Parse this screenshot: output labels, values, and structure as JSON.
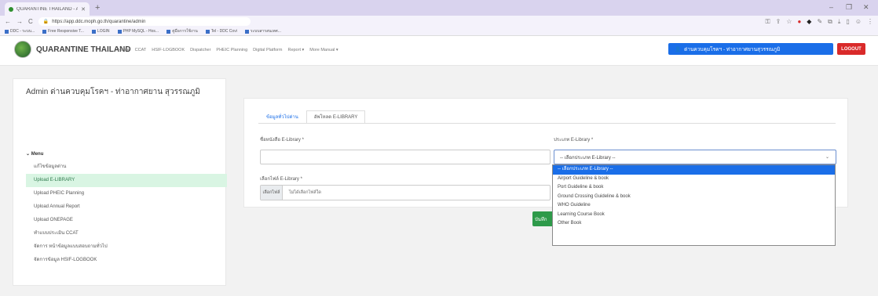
{
  "browser": {
    "tab_title": "QUARANTINE THAILAND - ADMIN",
    "new_tab": "+",
    "url": "https://app.ddc.moph.go.th/quarantine/admin",
    "nav_back": "←",
    "nav_forward": "→",
    "nav_reload": "C",
    "win_min": "–",
    "win_max": "❐",
    "win_close": "✕",
    "bookmarks": [
      "DDC - ระบบ...",
      "Free Responsive T...",
      "LOGIN",
      "PHP MySQL - Hos...",
      "คู่มือการใช้งาน",
      "Tel - DDC Covi",
      "ระบบสารสนเทศ..."
    ]
  },
  "navbar": {
    "brand": "QUARANTINE THAILAND",
    "links": [
      "Home",
      "CCAT",
      "HSIF-LOGBOOK",
      "Dispatcher",
      "PHEIC Planning",
      "Digital Platform",
      "Report ▾",
      "More Manual ▾"
    ],
    "user_label": "ด่านควบคุมโรคฯ - ท่าอากาศยานสุวรรณภูมิ",
    "logout": "LOGOUT"
  },
  "sidebar": {
    "title": "Admin ด่านควบคุมโรคฯ - ท่าอากาศยาน สุวรรณภูมิ",
    "menu_head": "⌄ Menu",
    "items": [
      {
        "label": "แก้ไขข้อมูลด่าน",
        "active": false
      },
      {
        "label": "Upload E-LIBRARY",
        "active": true
      },
      {
        "label": "Upload PHEIC Planning",
        "active": false
      },
      {
        "label": "Upload Annual Report",
        "active": false
      },
      {
        "label": "Upload ONEPAGE",
        "active": false
      },
      {
        "label": "ทำแบบประเมิน CCAT",
        "active": false
      },
      {
        "label": "จัดการ หน้าข้อมูลแบบสอบถามทั่วไป",
        "active": false
      },
      {
        "label": "จัดการข้อมูล HSIF-LOGBOOK",
        "active": false
      }
    ]
  },
  "form": {
    "tabs": [
      {
        "label": "ข้อมูลทั่วไปด่าน",
        "active": false
      },
      {
        "label": "อัพโหลด E-LIBRARY",
        "active": true
      }
    ],
    "name_label": "ชื่อหนังสือ E-Library *",
    "name_value": "",
    "file_label": "เลือกไฟล์ E-Library *",
    "file_choose": "เลือกไฟล์",
    "file_status": "ไม่ได้เลือกไฟล์ใด",
    "type_label": "ประเภท E-Library *",
    "type_value": "-- เลือกประเภท E-Library --",
    "save": "บันทึก"
  },
  "dropdown": {
    "options": [
      {
        "label": "-- เลือกประเภท E-Library --",
        "selected": true
      },
      {
        "label": "Airport Guideline & book",
        "selected": false
      },
      {
        "label": "Port Guideline & book",
        "selected": false
      },
      {
        "label": "Ground Crossing Guideline & book",
        "selected": false
      },
      {
        "label": "WHO Guideline",
        "selected": false
      },
      {
        "label": "Learning Course Book",
        "selected": false
      },
      {
        "label": "Other Book",
        "selected": false
      }
    ]
  },
  "colors": {
    "accent": "#1a6ee8",
    "logout": "#d92a2a",
    "save": "#2e9a4a",
    "active_menu_bg": "#d9f5e3"
  }
}
